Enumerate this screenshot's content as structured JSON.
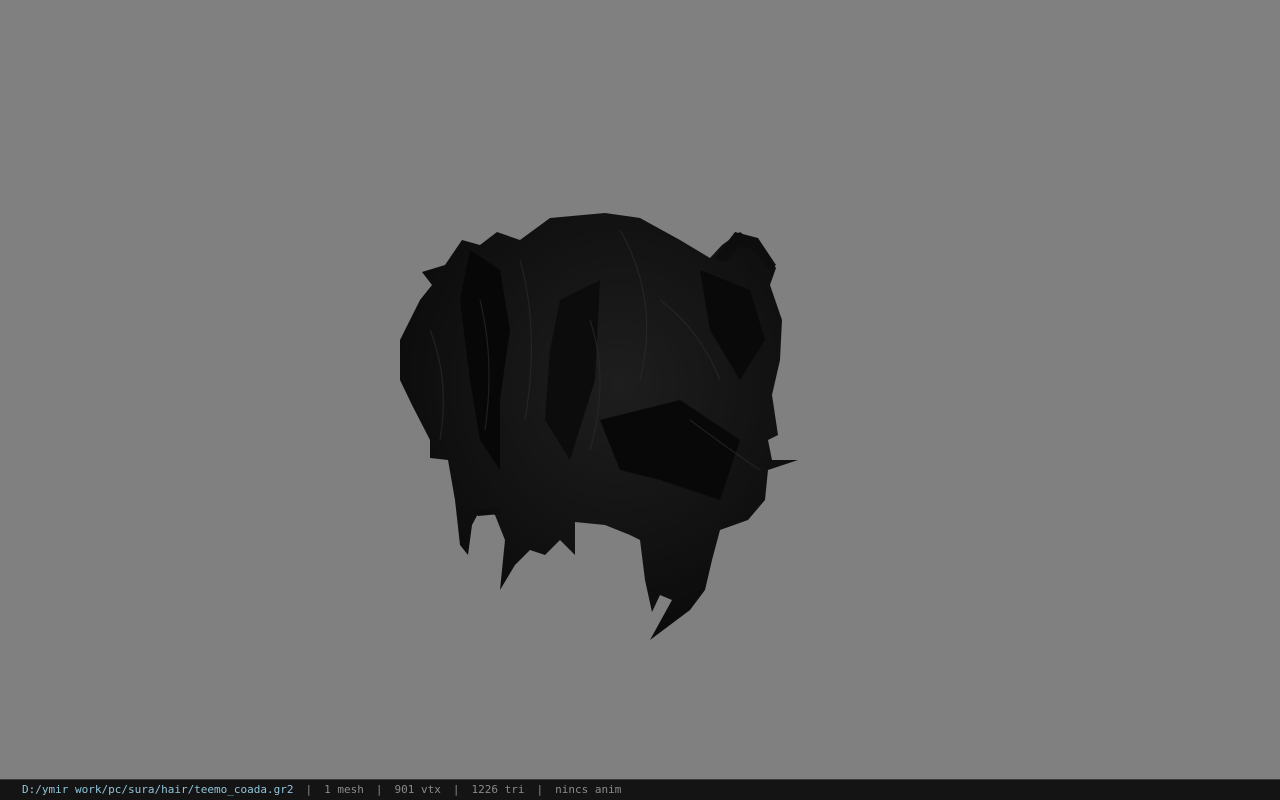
{
  "viewer": {
    "background_color": "#808080",
    "model_icon": "hair-mesh-icon",
    "model_color": "#111111"
  },
  "status": {
    "file_path": "D:/ymir work/pc/sura/hair/teemo_coada.gr2",
    "separator": "|",
    "mesh_count": "1 mesh",
    "vertex_count": "901 vtx",
    "triangle_count": "1226 tri",
    "anim_status": "nincs anim"
  }
}
